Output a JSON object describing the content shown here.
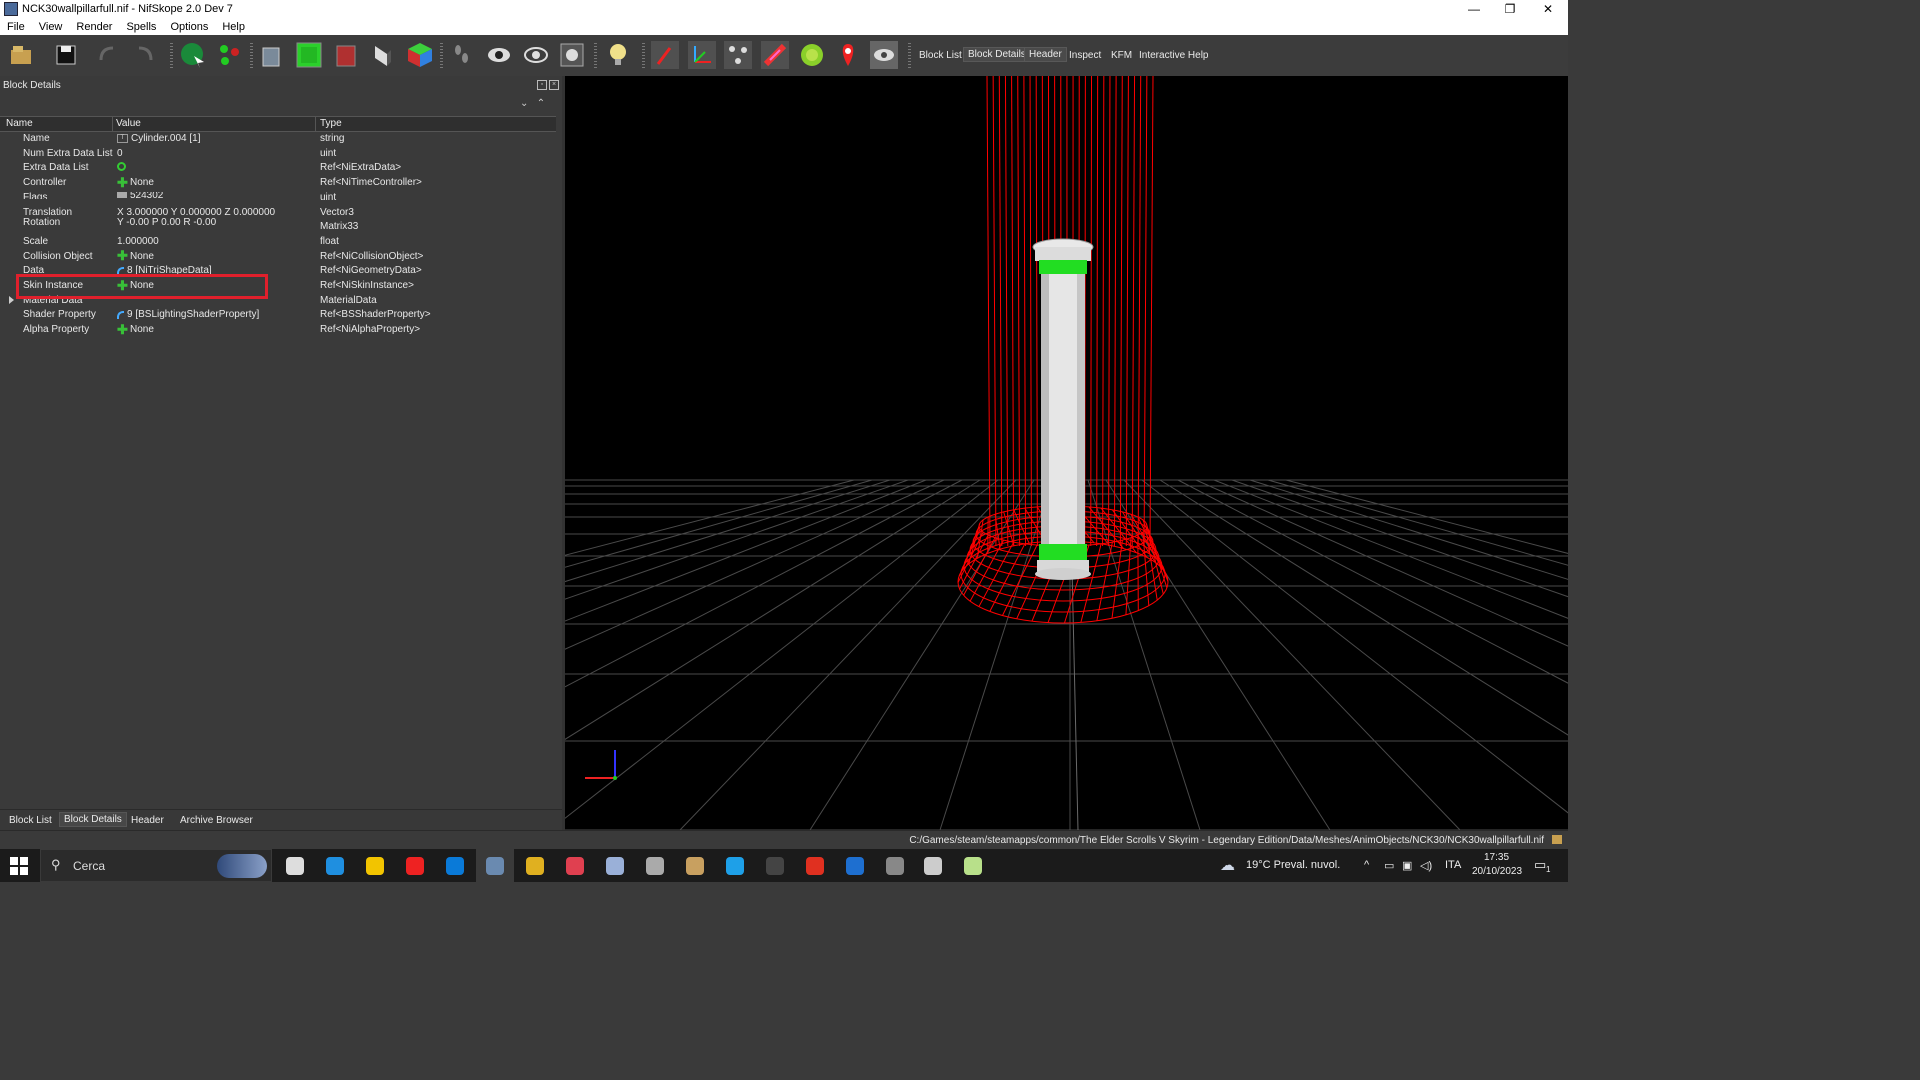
{
  "window": {
    "title": "NCK30wallpillarfull.nif - NifSkope 2.0 Dev 7",
    "controls": [
      "—",
      "❐",
      "✕"
    ]
  },
  "menu": [
    "File",
    "View",
    "Render",
    "Spells",
    "Options",
    "Help"
  ],
  "toolbar": {
    "icons": [
      "load-icon",
      "save-icon",
      "undo-icon",
      "redo-icon",
      "select-object-icon",
      "select-vertex-icon",
      "wireframe-cube-icon",
      "solid-cube-icon",
      "textured-cube-icon",
      "flip-normal-icon",
      "color-cube-icon",
      "footprints-icon",
      "eye-icon",
      "eye-outline-icon",
      "screenshot-icon",
      "lightbulb-icon",
      "pointer-icon",
      "axes-icon",
      "nodes-icon",
      "paint-icon",
      "globe-icon",
      "location-pin-icon",
      "hide-icon"
    ],
    "tabs": [
      "Block List",
      "Block Details",
      "Header",
      "Inspect",
      "KFM",
      "Interactive Help"
    ],
    "active_tab": "Block Details"
  },
  "panel": {
    "title": "Block Details",
    "columns": [
      "Name",
      "Value",
      "Type"
    ],
    "rows": [
      {
        "name": "Name",
        "value": "Cylinder.004 [1]",
        "type": "string",
        "icon": "text-icon"
      },
      {
        "name": "Num Extra Data List",
        "value": "0",
        "type": "uint",
        "icon": ""
      },
      {
        "name": "Extra Data List",
        "value": "",
        "type": "Ref<NiExtraData>",
        "icon": "refresh-icon"
      },
      {
        "name": "Controller",
        "value": "None",
        "type": "Ref<NiTimeController>",
        "icon": "plus-icon"
      },
      {
        "name": "Flags",
        "value": "524302",
        "type": "uint",
        "icon": "flag-icon"
      },
      {
        "name": "Translation",
        "value": "X 3.000000 Y 0.000000 Z 0.000000",
        "type": "Vector3",
        "icon": ""
      },
      {
        "name": "Rotation",
        "value": "Y -0.00 P 0.00 R -0.00",
        "type": "Matrix33",
        "icon": ""
      },
      {
        "name": "Scale",
        "value": "1.000000",
        "type": "float",
        "icon": ""
      },
      {
        "name": "Collision Object",
        "value": "None",
        "type": "Ref<NiCollisionObject>",
        "icon": "plus-icon"
      },
      {
        "name": "Data",
        "value": "8 [NiTriShapeData]",
        "type": "Ref<NiGeometryData>",
        "icon": "link-icon"
      },
      {
        "name": "Skin Instance",
        "value": "None",
        "type": "Ref<NiSkinInstance>",
        "icon": "plus-icon"
      },
      {
        "name": "Material Data",
        "value": "",
        "type": "MaterialData",
        "icon": ""
      },
      {
        "name": "Shader Property",
        "value": "9 [BSLightingShaderProperty]",
        "type": "Ref<BSShaderProperty>",
        "icon": "link-icon"
      },
      {
        "name": "Alpha Property",
        "value": "None",
        "type": "Ref<NiAlphaProperty>",
        "icon": "plus-icon"
      }
    ]
  },
  "bottom_tabs": [
    "Block List",
    "Block Details",
    "Header",
    "Archive Browser"
  ],
  "bottom_active": "Block Details",
  "status": {
    "path": "C:/Games/steam/steamapps/common/The Elder Scrolls V Skyrim - Legendary Edition/Data/Meshes/AnimObjects/NCK30/NCK30wallpillarfull.nif"
  },
  "taskbar": {
    "search_placeholder": "Cerca",
    "weather": "19°C  Preval. nuvol.",
    "lang": "ITA",
    "time": "17:35",
    "date": "20/10/2023",
    "notif_count": "1",
    "apps": [
      "task-view-icon",
      "edge-icon",
      "file-explorer-icon",
      "opera-icon",
      "store-icon",
      "nifskope-icon",
      "archive-icon",
      "settings-icon",
      "pen-icon",
      "gimp-icon",
      "paint-icon",
      "skype-icon",
      "terminal-icon",
      "f-app-icon",
      "window-icon",
      "arrow-icon",
      "audio-icon",
      "image-app-icon"
    ]
  },
  "colors": {
    "wireframe": "#ff0000",
    "highlight_box": "#e0202c",
    "green_band": "#22dd22"
  }
}
